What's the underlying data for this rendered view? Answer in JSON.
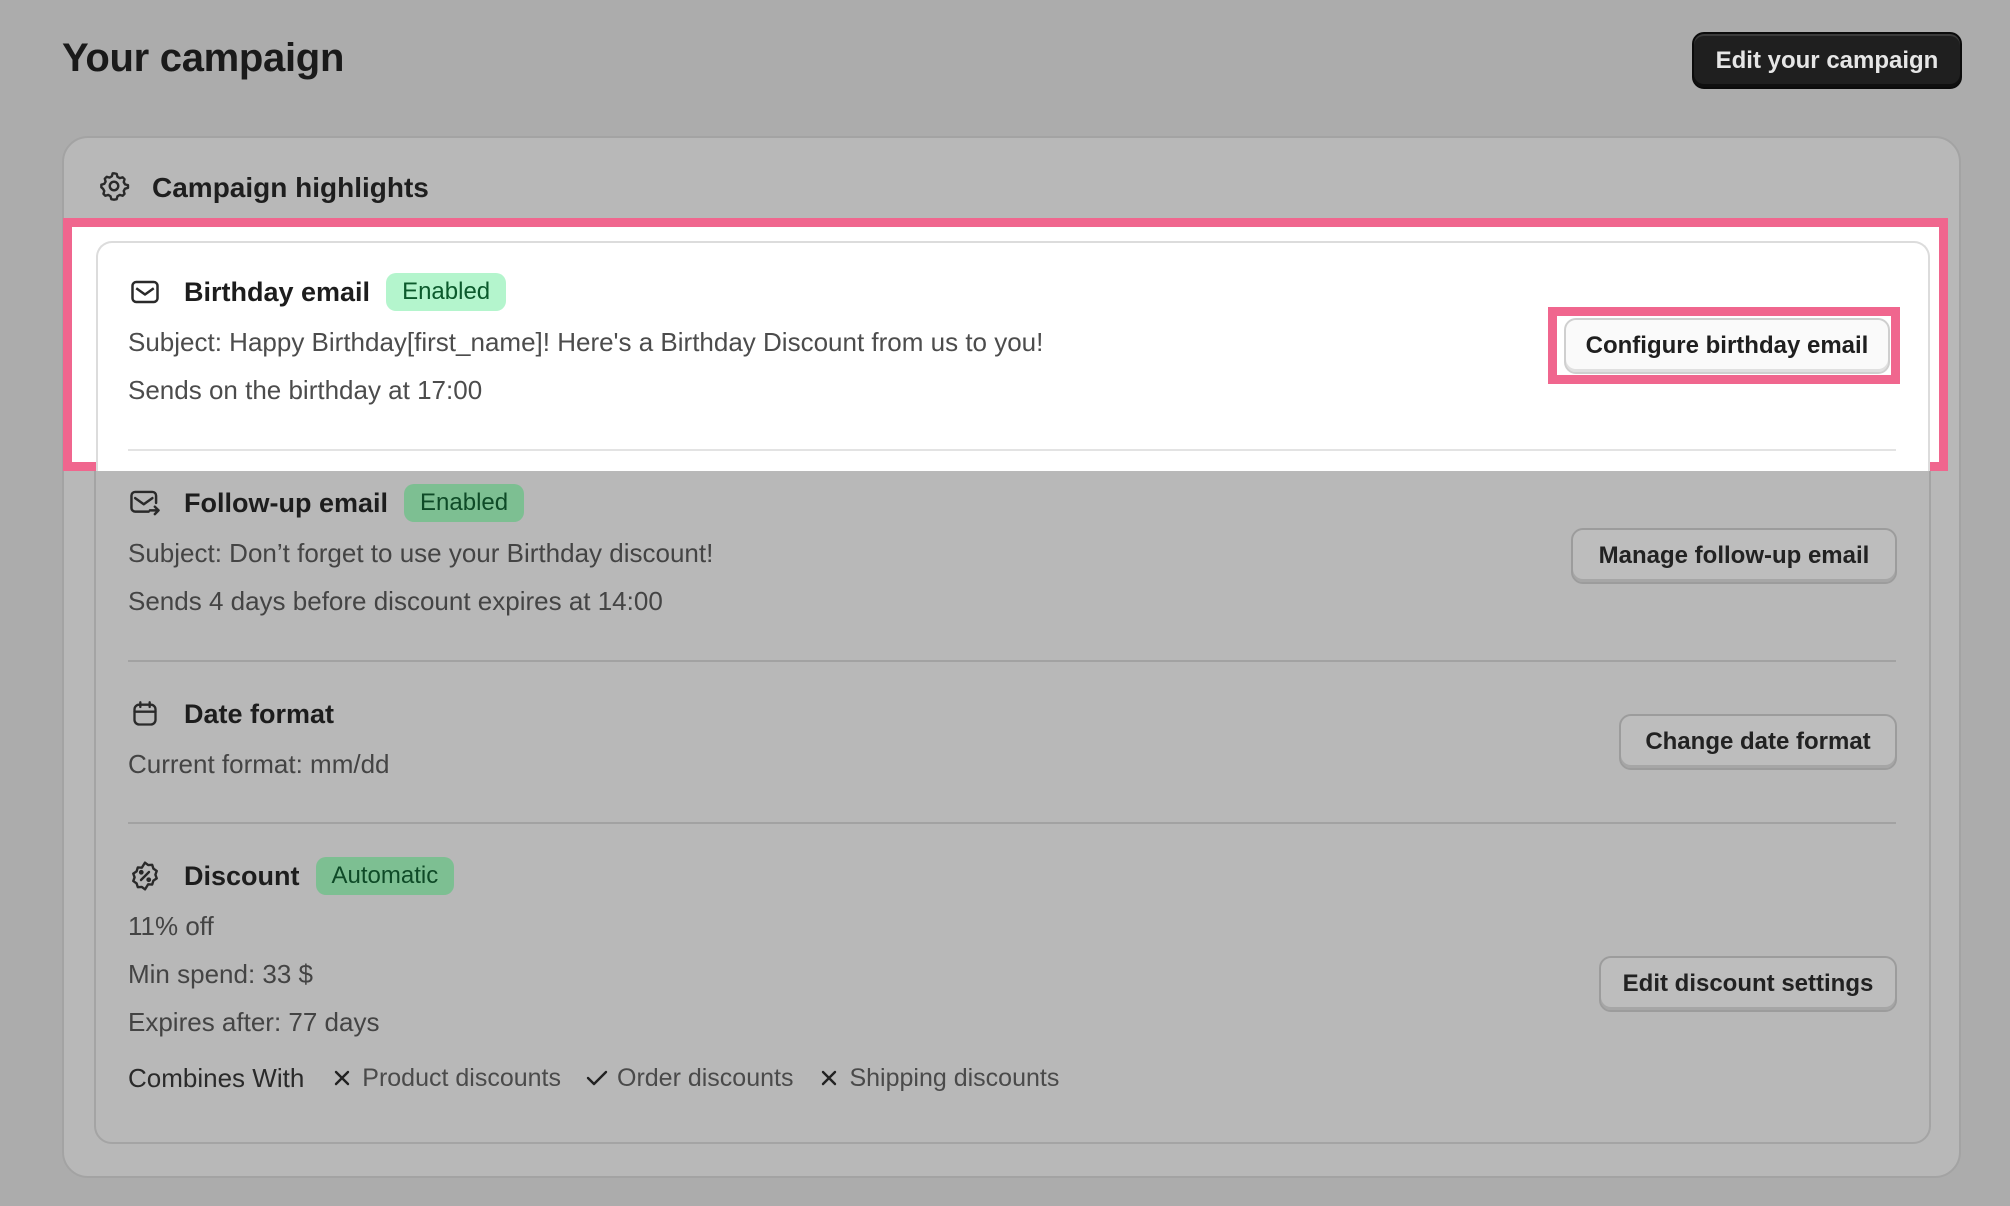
{
  "header": {
    "title": "Your campaign",
    "edit_button": "Edit your campaign"
  },
  "highlights": {
    "title": "Campaign highlights",
    "icon": "gear-icon"
  },
  "birthday_email": {
    "icon": "envelope-icon",
    "title": "Birthday email",
    "badge": "Enabled",
    "subject": "Subject: Happy Birthday[first_name]! Here's a Birthday Discount from us to you!",
    "schedule": "Sends on the birthday at 17:00",
    "button": "Configure birthday email"
  },
  "followup_email": {
    "icon": "envelope-arrow-icon",
    "title": "Follow-up email",
    "badge": "Enabled",
    "subject": "Subject: Don’t forget to use your Birthday discount!",
    "schedule": "Sends 4 days before discount expires at 14:00",
    "button": "Manage follow-up email"
  },
  "date_format": {
    "icon": "calendar-icon",
    "title": "Date format",
    "current": "Current format: mm/dd",
    "button": "Change date format"
  },
  "discount": {
    "icon": "discount-badge-icon",
    "title": "Discount",
    "badge": "Automatic",
    "amount": "11% off",
    "min_spend": "Min spend: 33 $",
    "expires": "Expires after: 77 days",
    "button": "Edit discount settings",
    "combines_label": "Combines With",
    "combines": [
      {
        "label": "Product discounts",
        "allowed": false
      },
      {
        "label": "Order discounts",
        "allowed": true
      },
      {
        "label": "Shipping discounts",
        "allowed": false
      }
    ]
  },
  "colors": {
    "highlight": "#f0668e",
    "background": "#acacac",
    "badge_enabled": "#b4f5cd"
  }
}
